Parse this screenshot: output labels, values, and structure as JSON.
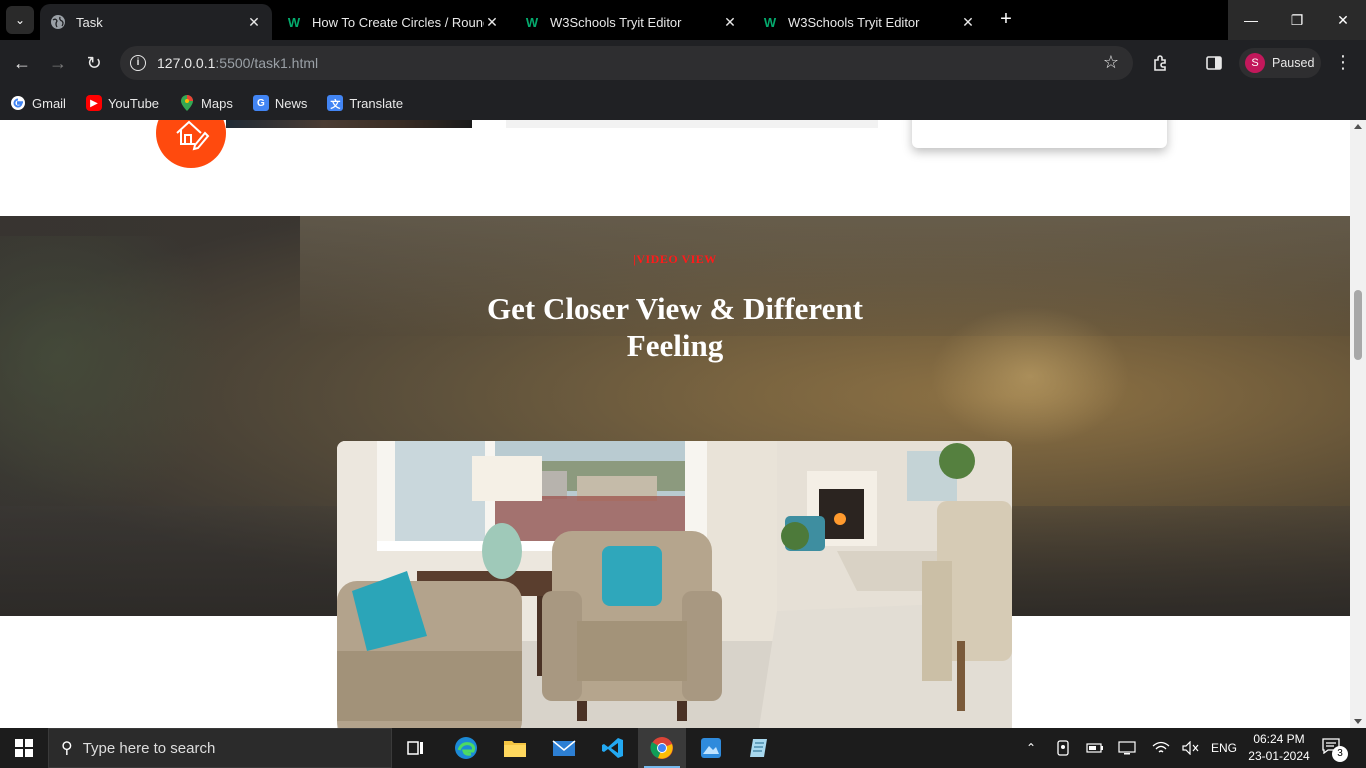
{
  "browser": {
    "tabs": [
      {
        "title": "Task",
        "active": true
      },
      {
        "title": "How To Create Circles / Round D",
        "active": false
      },
      {
        "title": "W3Schools Tryit Editor",
        "active": false
      },
      {
        "title": "W3Schools Tryit Editor",
        "active": false
      }
    ],
    "url_host": "127.0.0.1",
    "url_path": ":5500/task1.html",
    "profile_initial": "S",
    "profile_status": "Paused",
    "bookmarks": [
      {
        "label": "Gmail"
      },
      {
        "label": "YouTube"
      },
      {
        "label": "Maps"
      },
      {
        "label": "News"
      },
      {
        "label": "Translate"
      }
    ]
  },
  "page": {
    "video_section": {
      "tag": "|VIDEO VIEW",
      "heading": "Get Closer View & Different Feeling"
    },
    "colors": {
      "accent_red": "#ff1a1a",
      "icon_orange": "#ff4a0e"
    }
  },
  "taskbar": {
    "search_placeholder": "Type here to search",
    "language": "ENG",
    "time": "06:24 PM",
    "date": "23-01-2024",
    "notification_count": "3"
  }
}
